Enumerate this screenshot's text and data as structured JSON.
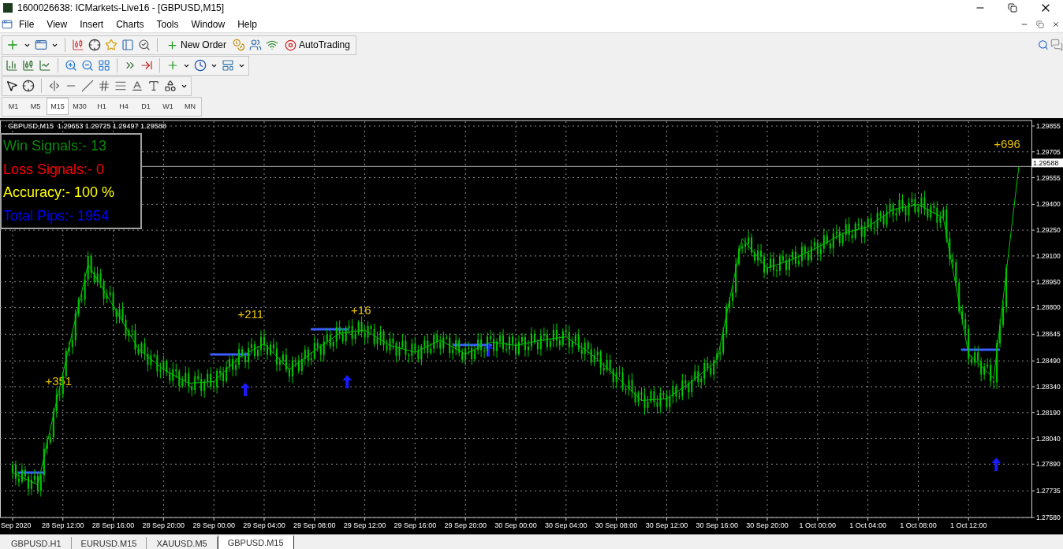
{
  "window": {
    "title": "1600026638: ICMarkets-Live16 - [GBPUSD,M15]"
  },
  "menu": [
    "File",
    "View",
    "Insert",
    "Charts",
    "Tools",
    "Window",
    "Help"
  ],
  "toolbar": {
    "new_order": "New Order",
    "auto_trading": "AutoTrading"
  },
  "timeframes": [
    {
      "label": "M1",
      "selected": false
    },
    {
      "label": "M5",
      "selected": false
    },
    {
      "label": "M15",
      "selected": true
    },
    {
      "label": "M30",
      "selected": false
    },
    {
      "label": "H1",
      "selected": false
    },
    {
      "label": "H4",
      "selected": false
    },
    {
      "label": "D1",
      "selected": false
    },
    {
      "label": "W1",
      "selected": false
    },
    {
      "label": "MN",
      "selected": false
    }
  ],
  "chart": {
    "header_prices": "1.29653 1.29725 1.29497 1.29588",
    "current_price": "1.29588",
    "stats": [
      {
        "text": "Win Signals:- 13",
        "color": "#0a8a0a"
      },
      {
        "text": "Loss Signals:- 0",
        "color": "#ff0000"
      },
      {
        "text": "Accuracy:- 100 %",
        "color": "#ffff00"
      },
      {
        "text": "Total Pips:- 1954",
        "color": "#0000ff"
      }
    ],
    "chart_data": {
      "type": "line",
      "grid": true,
      "ylim": [
        1.2758,
        1.29855
      ],
      "categories": [
        "Sep 2020",
        null,
        "28 Sep 12:00",
        null,
        "28 Sep 16:00",
        null,
        "28 Sep 20:00",
        null,
        "29 Sep 00:00",
        null,
        "29 Sep 04:00",
        null,
        "29 Sep 08:00",
        null,
        "29 Sep 12:00",
        null,
        "29 Sep 16:00",
        null,
        "29 Sep 20:00",
        null,
        "30 Sep 00:00",
        null,
        "30 Sep 04:00",
        null,
        "30 Sep 08:00",
        null,
        "30 Sep 12:00",
        null,
        "30 Sep 16:00",
        null,
        "30 Sep 20:00",
        null,
        "1 Oct 00:00",
        null,
        "1 Oct 04:00",
        null,
        "1 Oct 08:00",
        null,
        "1 Oct 12:00",
        null,
        null
      ],
      "series": [
        {
          "name": "GBPUSD,M15",
          "color": "#00c800",
          "values": [
            1.2784,
            1.2777,
            1.2842,
            1.2905,
            1.2881,
            1.2856,
            1.2844,
            1.2836,
            1.2837,
            1.2851,
            1.2859,
            1.2844,
            1.2855,
            1.2865,
            1.2867,
            1.2858,
            1.2854,
            1.2861,
            1.2853,
            1.286,
            1.2858,
            1.2861,
            1.2863,
            1.2853,
            1.284,
            1.2826,
            1.2827,
            1.2837,
            1.2849,
            1.292,
            1.2903,
            1.2908,
            1.2915,
            1.2923,
            1.2927,
            1.2937,
            1.294,
            1.2932,
            1.2853,
            1.2839,
            1.2962
          ]
        }
      ],
      "yticks": [
        {
          "value": 1.2758,
          "label": "1.27580"
        },
        {
          "value": 1.27735,
          "label": "1.27735"
        },
        {
          "value": 1.2789,
          "label": "1.27890"
        },
        {
          "value": 1.2804,
          "label": "1.28040"
        },
        {
          "value": 1.2819,
          "label": "1.28190"
        },
        {
          "value": 1.2834,
          "label": "1.28340"
        },
        {
          "value": 1.2849,
          "label": "1.28490"
        },
        {
          "value": 1.28645,
          "label": "1.28645"
        },
        {
          "value": 1.288,
          "label": "1.28800"
        },
        {
          "value": 1.2895,
          "label": "1.28950"
        },
        {
          "value": 1.291,
          "label": "1.29100"
        },
        {
          "value": 1.2925,
          "label": "1.29250"
        },
        {
          "value": 1.294,
          "label": "1.29400"
        },
        {
          "value": 1.29555,
          "label": "1.29555"
        },
        {
          "value": 1.29705,
          "label": "1.29705"
        },
        {
          "value": 1.29855,
          "label": "1.29855"
        }
      ],
      "annotations": [
        "+351",
        "+211",
        "+16",
        "+696"
      ]
    }
  },
  "tabs": [
    {
      "label": "GBPUSD.H1",
      "selected": false
    },
    {
      "label": "EURUSD.M15",
      "selected": false
    },
    {
      "label": "XAUUSD.M5",
      "selected": false
    },
    {
      "label": "GBPUSD.M15",
      "selected": true
    }
  ]
}
